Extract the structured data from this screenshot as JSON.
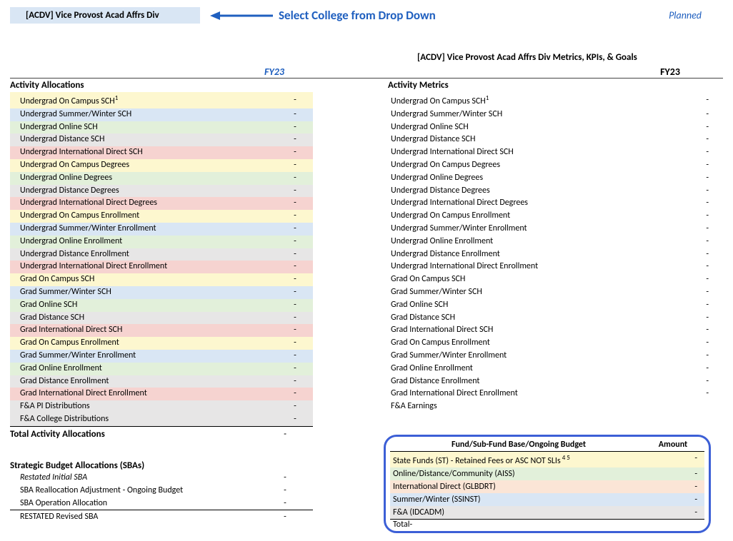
{
  "top": {
    "dropdown_value": "[ACDV] Vice Provost Acad Affrs Div",
    "arrow_label": "Select College from Drop Down",
    "planned": "Planned"
  },
  "metrics_title": "[ACDV] Vice Provost Acad Affrs Div Metrics, KPIs, & Goals",
  "fy_left": "FY23",
  "fy_right": "FY23",
  "left": {
    "header": "Activity Allocations",
    "rows": [
      {
        "label": "Undergrad On Campus SCH",
        "sup": "1",
        "color": "c-yellow",
        "val": "-"
      },
      {
        "label": "Undergrad Summer/Winter SCH",
        "color": "c-blue",
        "val": "-"
      },
      {
        "label": "Undergrad Online SCH",
        "color": "c-green",
        "val": "-"
      },
      {
        "label": "Undergrad Distance SCH",
        "color": "c-grey",
        "val": "-"
      },
      {
        "label": "Undergrad International Direct SCH",
        "color": "c-red",
        "val": "-"
      },
      {
        "label": "Undergrad On Campus Degrees",
        "color": "c-yellow",
        "val": "-"
      },
      {
        "label": "Undergrad Online Degrees",
        "color": "c-green",
        "val": "-"
      },
      {
        "label": "Undergrad Distance Degrees",
        "color": "c-grey",
        "val": "-"
      },
      {
        "label": "Undergrad International Direct Degrees",
        "color": "c-red",
        "val": "-"
      },
      {
        "label": "Undergrad On Campus Enrollment",
        "color": "c-yellow",
        "val": "-"
      },
      {
        "label": "Undergrad Summer/Winter Enrollment",
        "color": "c-blue",
        "val": "-"
      },
      {
        "label": "Undergrad Online Enrollment",
        "color": "c-green",
        "val": "-"
      },
      {
        "label": "Undergrad Distance Enrollment",
        "color": "c-grey",
        "val": "-"
      },
      {
        "label": "Undergrad International Direct Enrollment",
        "color": "c-red",
        "val": "-"
      },
      {
        "label": "Grad On Campus SCH",
        "color": "c-yellow",
        "val": "-"
      },
      {
        "label": "Grad Summer/Winter SCH",
        "color": "c-blue",
        "val": "-"
      },
      {
        "label": "Grad Online SCH",
        "color": "c-green",
        "val": "-"
      },
      {
        "label": "Grad Distance SCH",
        "color": "c-grey",
        "val": "-"
      },
      {
        "label": "Grad International Direct SCH",
        "color": "c-red",
        "val": "-"
      },
      {
        "label": "Grad On Campus Enrollment",
        "color": "c-yellow",
        "val": "-"
      },
      {
        "label": "Grad Summer/Winter Enrollment",
        "color": "c-blue",
        "val": "-"
      },
      {
        "label": "Grad Online Enrollment",
        "color": "c-green",
        "val": "-"
      },
      {
        "label": "Grad Distance Enrollment",
        "color": "c-grey",
        "val": "-"
      },
      {
        "label": "Grad International Direct Enrollment",
        "color": "c-red",
        "val": "-"
      },
      {
        "label": "F&A PI Distributions",
        "color": "c-grey",
        "val": "-"
      },
      {
        "label": "F&A College Distributions",
        "color": "c-grey",
        "val": "-"
      }
    ],
    "total_label": "Total Activity Allocations",
    "total_val": "-"
  },
  "sba": {
    "header": "Strategic Budget Allocations (SBAs)",
    "rows": [
      {
        "label": "Restated Initial SBA",
        "val": "-",
        "italic": true
      },
      {
        "label": "SBA Reallocation Adjustment - Ongoing Budget",
        "val": "-"
      },
      {
        "label": "SBA Operation Allocation",
        "val": "-"
      }
    ],
    "restated_label": "RESTATED Revised SBA",
    "restated_val": "-"
  },
  "right": {
    "header": "Activity Metrics",
    "rows": [
      {
        "label": "Undergrad On Campus SCH",
        "sup": "1",
        "val": "-"
      },
      {
        "label": "Undergrad Summer/Winter SCH",
        "val": "-"
      },
      {
        "label": "Undergrad Online SCH",
        "val": "-"
      },
      {
        "label": "Undergrad Distance SCH",
        "val": "-"
      },
      {
        "label": "Undergrad International Direct SCH",
        "val": "-"
      },
      {
        "label": "Undergrad On Campus Degrees",
        "val": "-"
      },
      {
        "label": "Undergrad Online Degrees",
        "val": "-"
      },
      {
        "label": "Undergrad Distance Degrees",
        "val": "-"
      },
      {
        "label": "Undergrad International Direct Degrees",
        "val": "-"
      },
      {
        "label": "Undergrad On Campus Enrollment",
        "val": "-"
      },
      {
        "label": "Undergrad Summer/Winter Enrollment",
        "val": "-"
      },
      {
        "label": "Undergrad Online Enrollment",
        "val": "-"
      },
      {
        "label": "Undergrad Distance Enrollment",
        "val": "-"
      },
      {
        "label": "Undergrad International Direct Enrollment",
        "val": "-"
      },
      {
        "label": "Grad On Campus SCH",
        "val": "-"
      },
      {
        "label": "Grad Summer/Winter SCH",
        "val": "-"
      },
      {
        "label": "Grad Online SCH",
        "val": "-"
      },
      {
        "label": "Grad Distance SCH",
        "val": "-"
      },
      {
        "label": "Grad International Direct SCH",
        "val": "-"
      },
      {
        "label": "Grad On Campus Enrollment",
        "val": "-"
      },
      {
        "label": "Grad Summer/Winter Enrollment",
        "val": "-"
      },
      {
        "label": "Grad Online Enrollment",
        "val": "-"
      },
      {
        "label": "Grad Distance Enrollment",
        "val": "-"
      },
      {
        "label": "Grad International Direct Enrollment",
        "val": "-"
      },
      {
        "label": "F&A Earnings",
        "val": ""
      }
    ]
  },
  "fund": {
    "head_label": "Fund/Sub-Fund Base/Ongoing Budget",
    "head_amount": "Amount",
    "rows": [
      {
        "label": "State Funds (ST) - Retained Fees or ASC NOT SLIs",
        "sup": "4 5",
        "color": "c-yellow",
        "val": "-"
      },
      {
        "label": "Online/Distance/Community (AISS)",
        "color": "c-green",
        "val": "-"
      },
      {
        "label": "International Direct (GLBDRT)",
        "color": "c-orange",
        "val": "-"
      },
      {
        "label": "Summer/Winter (SSINST)",
        "color": "c-blue",
        "val": "-"
      },
      {
        "label": "F&A (IDCADM)",
        "color": "c-grey",
        "val": "-"
      }
    ],
    "total_label": "Total",
    "total_val": "-"
  }
}
